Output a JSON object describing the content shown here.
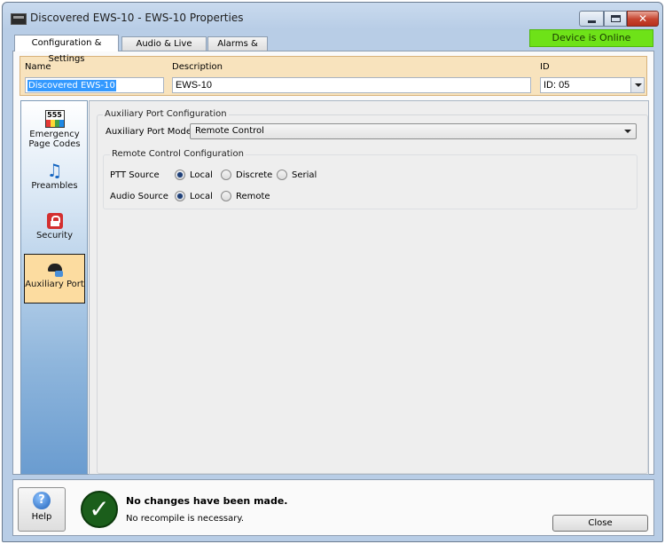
{
  "window": {
    "title": "Discovered EWS-10 - EWS-10 Properties"
  },
  "tabs": [
    {
      "label": "Configuration & Settings",
      "active": true
    },
    {
      "label": "Audio & Live Control",
      "active": false
    },
    {
      "label": "Alarms & Logs",
      "active": false
    }
  ],
  "status": {
    "text": "Device is Online",
    "color": "#6ee218"
  },
  "properties": {
    "name_label": "Name",
    "name_value": "Discovered EWS-10",
    "description_label": "Description",
    "description_value": "EWS-10",
    "id_label": "ID",
    "id_value": "ID: 05"
  },
  "sidebar": {
    "items": [
      {
        "label": "Emergency Page Codes",
        "icon": "emergency-page-codes-icon"
      },
      {
        "label": "Preambles",
        "icon": "music-note-icon"
      },
      {
        "label": "Security",
        "icon": "lock-icon"
      },
      {
        "label": "Auxiliary Port",
        "icon": "auxiliary-port-icon",
        "active": true
      }
    ]
  },
  "aux": {
    "group_title": "Auxiliary Port Configuration",
    "mode_label": "Auxiliary Port Mode",
    "mode_value": "Remote Control",
    "remote": {
      "title": "Remote Control Configuration",
      "ptt_label": "PTT Source",
      "ptt_options": [
        "Local",
        "Discrete",
        "Serial"
      ],
      "ptt_selected": "Local",
      "audio_label": "Audio Source",
      "audio_options": [
        "Local",
        "Remote"
      ],
      "audio_selected": "Local"
    }
  },
  "footer": {
    "help_label": "Help",
    "message_main": "No changes have been made.",
    "message_sub": "No recompile is necessary.",
    "close_label": "Close"
  }
}
